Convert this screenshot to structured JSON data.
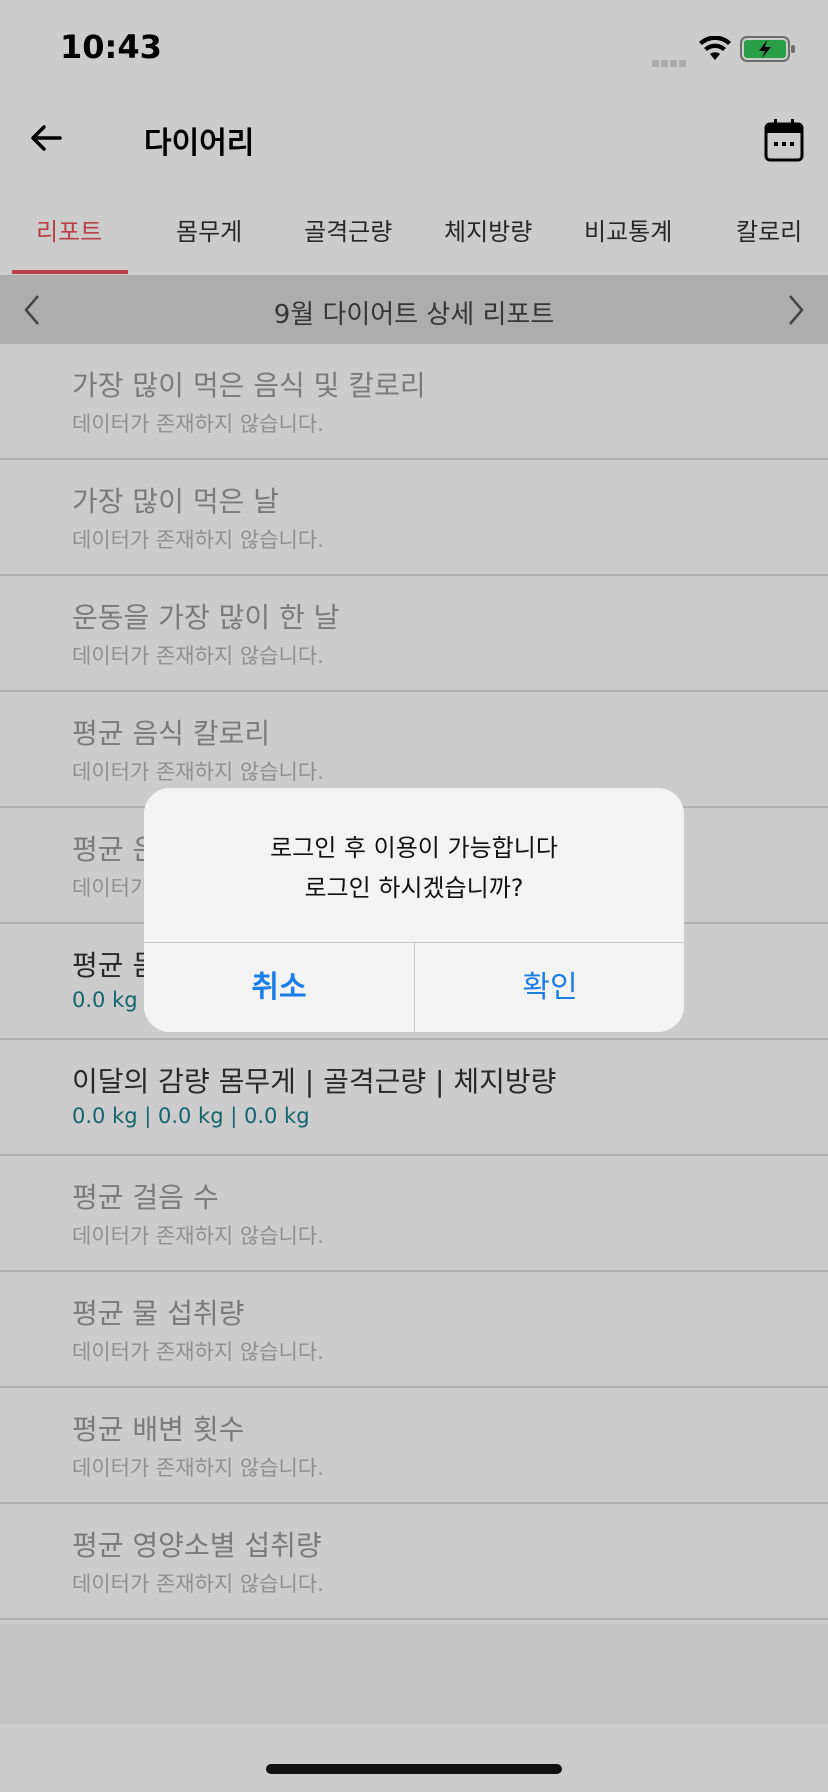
{
  "status_bar": {
    "time": "10:43"
  },
  "header": {
    "title": "다이어리"
  },
  "tabs": [
    {
      "label": "리포트",
      "active": true
    },
    {
      "label": "몸무게",
      "active": false
    },
    {
      "label": "골격근량",
      "active": false
    },
    {
      "label": "체지방량",
      "active": false
    },
    {
      "label": "비교통계",
      "active": false
    },
    {
      "label": "칼로리",
      "active": false
    }
  ],
  "month_bar": {
    "title": "9월 다이어트 상세 리포트"
  },
  "report_items": [
    {
      "title": "가장 많이 먹은 음식 및 칼로리",
      "value": "데이터가 존재하지 않습니다."
    },
    {
      "title": "가장 많이 먹은 날",
      "value": "데이터가 존재하지 않습니다."
    },
    {
      "title": "운동을 가장 많이 한 날",
      "value": "데이터가 존재하지 않습니다."
    },
    {
      "title": "평균 음식 칼로리",
      "value": "데이터가 존재하지 않습니다."
    },
    {
      "title": "평균 운",
      "value": "데이터가"
    },
    {
      "title": "평균 몸",
      "value": "0.0 kg"
    },
    {
      "title": "이달의 감량 몸무게 | 골격근량 | 체지방량",
      "value": "0.0 kg | 0.0 kg | 0.0 kg"
    },
    {
      "title": "평균 걸음 수",
      "value": "데이터가 존재하지 않습니다."
    },
    {
      "title": "평균 물 섭취량",
      "value": "데이터가 존재하지 않습니다."
    },
    {
      "title": "평균 배변 횟수",
      "value": "데이터가 존재하지 않습니다."
    },
    {
      "title": "평균 영양소별 섭취량",
      "value": "데이터가 존재하지 않습니다."
    }
  ],
  "dialog": {
    "line1": "로그인 후 이용이 가능합니다",
    "line2": "로그인 하시겠습니까?",
    "cancel_label": "취소",
    "confirm_label": "확인"
  },
  "colors": {
    "accent": "#e8505b",
    "value_teal": "#1a7f8a",
    "dialog_button": "#1a7ee6"
  },
  "icons": [
    "back-arrow-icon",
    "calendar-icon",
    "chevron-left-icon",
    "chevron-right-icon",
    "wifi-icon",
    "battery-charging-icon"
  ]
}
